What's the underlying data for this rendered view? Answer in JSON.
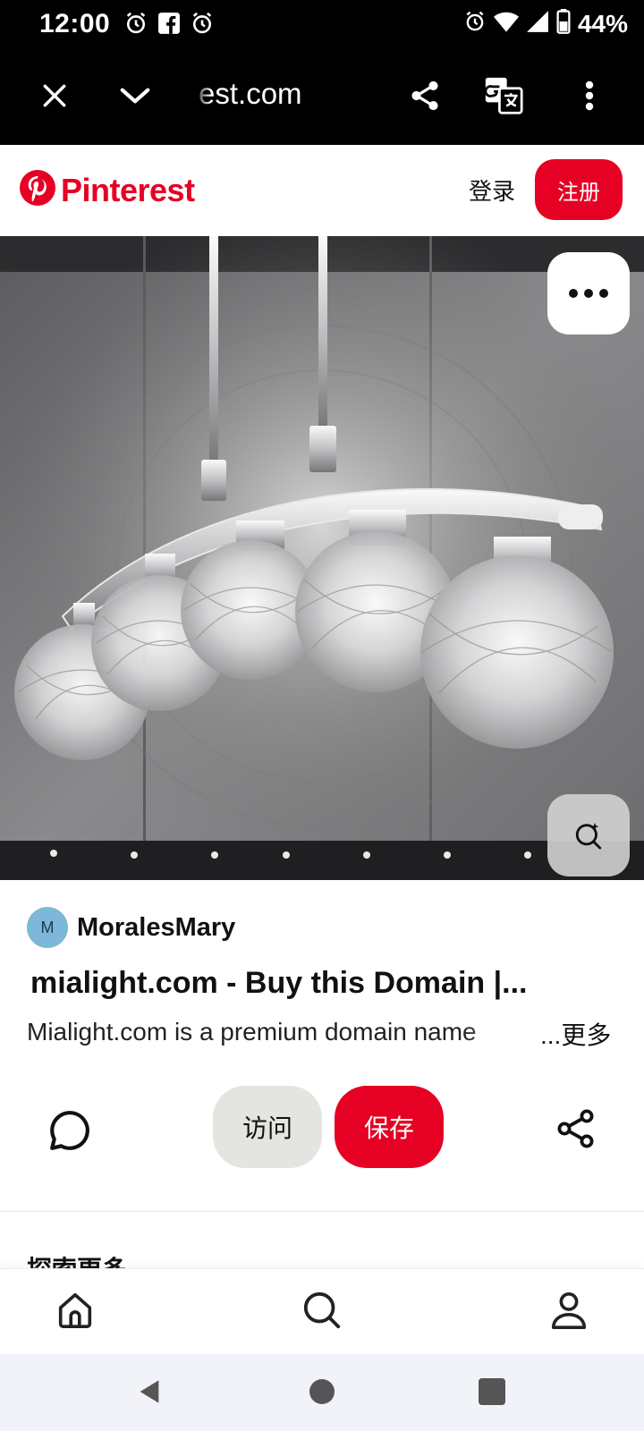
{
  "status_bar": {
    "time": "12:00",
    "battery": "44%",
    "icons": [
      "alarm-icon",
      "facebook-icon",
      "alarm-icon",
      "alarm-icon",
      "wifi-icon",
      "signal-icon",
      "battery-icon"
    ]
  },
  "browser": {
    "url": "est.com",
    "icons": [
      "close-icon",
      "chevron-down-icon",
      "share-icon",
      "translate-icon",
      "more-vert-icon"
    ]
  },
  "header": {
    "logo_text": "Pinterest",
    "login_label": "登录",
    "signup_label": "注册",
    "brand_color": "#e60023"
  },
  "pin": {
    "author_initial": "M",
    "author_name": "MoralesMary",
    "title": "mialight.com - Buy this Domain |...",
    "description": "Mialight.com is a premium domain name",
    "more_label": "...更多",
    "hero_icons": [
      "more-horiz-icon",
      "visual-search-icon"
    ]
  },
  "actions": {
    "visit_label": "访问",
    "save_label": "保存",
    "icons": [
      "comment-icon",
      "share-icon"
    ]
  },
  "more_ideas_label": "探索更多",
  "bottom_nav": {
    "items": [
      "home-icon",
      "search-icon",
      "profile-icon"
    ]
  },
  "system_nav": {
    "items": [
      "back-icon",
      "home-circle-icon",
      "recents-icon"
    ]
  }
}
